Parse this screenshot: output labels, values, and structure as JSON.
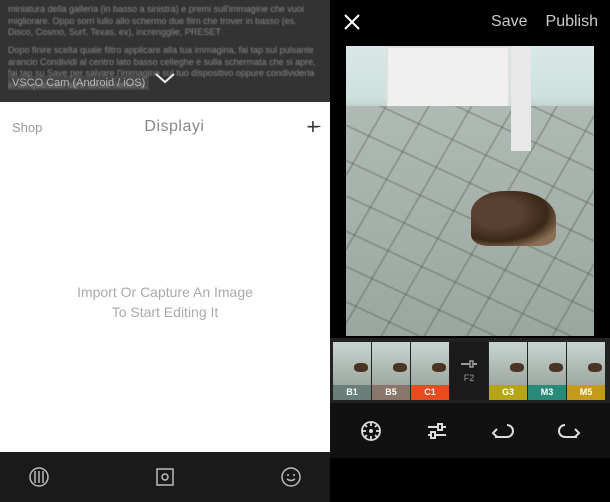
{
  "left": {
    "overlay_text_1": "miniatura della galleria (in basso a sinistra) e premi sull'immagine che vuoi migliorare. Oppo sorri lullo allo schermo due film che trover in basso (es. Disco, Cosmo, Surf, Texas, ex), increngglie, PRESET",
    "overlay_text_2": "Dopo finire scelta quale filtro applicare alla tua immagina, fai tap sul pulsante arancio Condividi al centro lato basso celleghe e sulla schermata che si apre, fai tap su Save per salvare l'immagine sul tuo dispositivo oppure condividerla in un qualsiasi altro social network.",
    "app_name": "VSCO Cam (Android / iOS)",
    "shop": "Shop",
    "title": "Displayi",
    "empty_line_1": "Import Or Capture An Image",
    "empty_line_2": "To Start Editing It"
  },
  "right": {
    "save": "Save",
    "publish": "Publish"
  },
  "filters": [
    {
      "label": "B1",
      "color": "#6a7e7a"
    },
    {
      "label": "B5",
      "color": "#89756a"
    },
    {
      "label": "C1",
      "color": "#e84b1f"
    },
    {
      "label": "G3",
      "color": "#b5a516"
    },
    {
      "label": "M3",
      "color": "#2a8a7a"
    },
    {
      "label": "M5",
      "color": "#c49a1a"
    }
  ],
  "tools_label": "F2"
}
